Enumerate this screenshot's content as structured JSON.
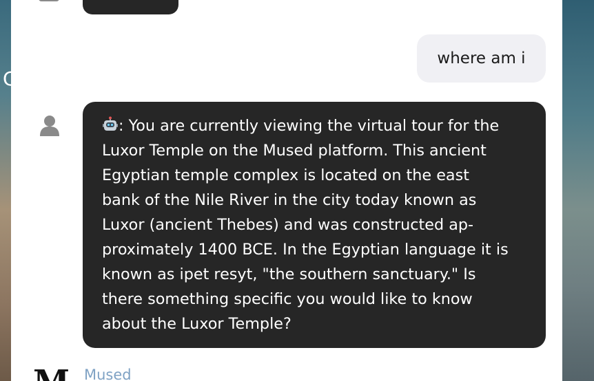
{
  "background": {
    "left_letter": "C"
  },
  "conversation": {
    "user_message": "where am i",
    "assistant_message": {
      "lines": [
        ": You are currently viewing the virtual tour for the",
        "Luxor Temple on the Mused platform. This ancient",
        "Egyptian temple complex is located on the east",
        "bank of the Nile River in the city today known as",
        "Luxor (ancient Thebes) and was constructed ap-",
        "proximately 1400 BCE. In the Egyptian language it is",
        "known as ipet resyt, \"the southern sanctuary.\" Is",
        "there something specific you would like to know",
        "about the Luxor Temple?"
      ],
      "leading_icon": "robot-icon"
    },
    "next_sender": {
      "logo_letter": "M",
      "name": "Mused"
    }
  },
  "colors": {
    "assistant_bubble": "#262626",
    "user_bubble": "#f0f0f4",
    "brand_name": "#7fa2c4"
  }
}
